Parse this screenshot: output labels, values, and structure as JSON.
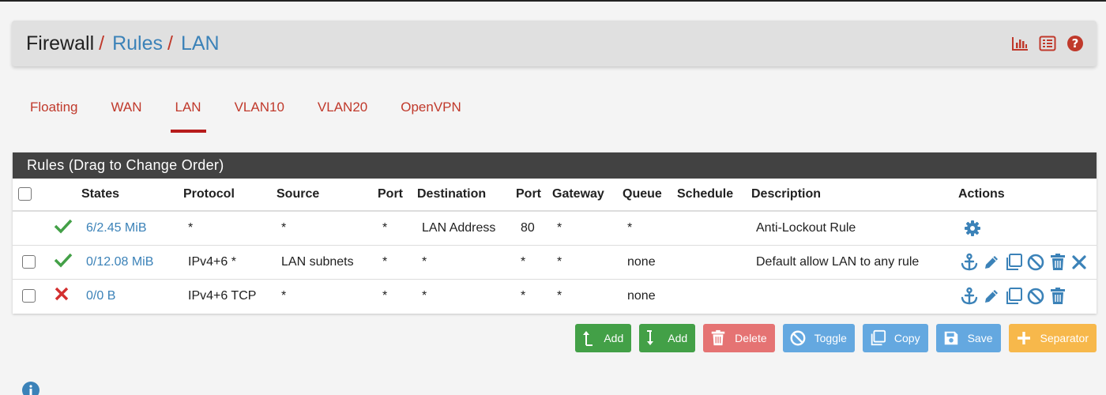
{
  "breadcrumb": {
    "part1": "Firewall",
    "part2": "Rules",
    "part3": "LAN",
    "separator": "/"
  },
  "header_icons": [
    "chart-icon",
    "list-icon",
    "help-icon"
  ],
  "tabs": [
    {
      "label": "Floating",
      "active": false
    },
    {
      "label": "WAN",
      "active": false
    },
    {
      "label": "LAN",
      "active": true
    },
    {
      "label": "VLAN10",
      "active": false
    },
    {
      "label": "VLAN20",
      "active": false
    },
    {
      "label": "OpenVPN",
      "active": false
    }
  ],
  "panel": {
    "title": "Rules (Drag to Change Order)"
  },
  "table": {
    "headers": {
      "states": "States",
      "protocol": "Protocol",
      "source": "Source",
      "port": "Port",
      "destination": "Destination",
      "dport": "Port",
      "gateway": "Gateway",
      "queue": "Queue",
      "schedule": "Schedule",
      "description": "Description",
      "actions": "Actions"
    },
    "rows": [
      {
        "status": "pass",
        "states": "6/2.45 MiB",
        "protocol": "*",
        "source": "*",
        "port": "*",
        "destination": "LAN Address",
        "dport": "80",
        "gateway": "*",
        "queue": "*",
        "schedule": "",
        "description": "Anti-Lockout Rule"
      },
      {
        "status": "pass",
        "states": "0/12.08 MiB",
        "protocol": "IPv4+6 *",
        "source": "LAN subnets",
        "port": "*",
        "destination": "*",
        "dport": "*",
        "gateway": "*",
        "queue": "none",
        "schedule": "",
        "description": "Default allow LAN to any rule"
      },
      {
        "status": "block",
        "states": "0/0 B",
        "protocol": "IPv4+6 TCP",
        "source": "*",
        "port": "*",
        "destination": "*",
        "dport": "*",
        "gateway": "*",
        "queue": "none",
        "schedule": "",
        "description": ""
      }
    ]
  },
  "buttons": {
    "add_top": "Add",
    "add_bottom": "Add",
    "delete": "Delete",
    "toggle": "Toggle",
    "copy": "Copy",
    "save": "Save",
    "separator": "Separator"
  },
  "colors": {
    "link": "#3b82b8",
    "tab_red": "#c0392b",
    "panel_head": "#424242",
    "green": "#43a047",
    "red_btn": "#e57373",
    "blue_btn": "#64a8e0",
    "orange_btn": "#f7b84b"
  }
}
